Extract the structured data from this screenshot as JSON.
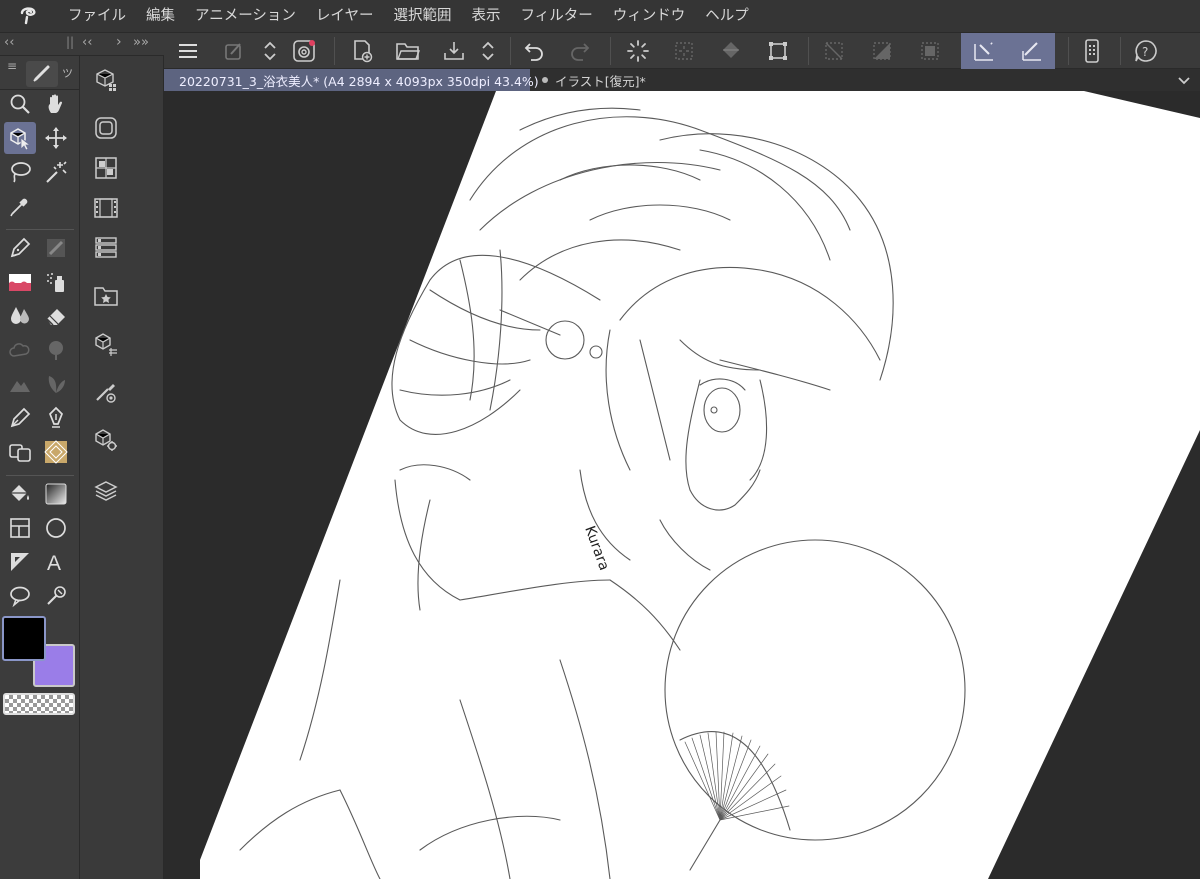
{
  "menu": {
    "items": [
      "ファイル",
      "編集",
      "アニメーション",
      "レイヤー",
      "選択範囲",
      "表示",
      "フィルター",
      "ウィンドウ",
      "ヘルプ"
    ]
  },
  "palette_header": {
    "collapse_left": "‹‹",
    "grip": "||",
    "collapse_right": "‹‹",
    "nav_right": "›",
    "expand_right": "»»"
  },
  "tool_tabs": {
    "menu_icon": "≡",
    "sub_label": "ツ"
  },
  "tabs": [
    {
      "label": "20220731_3_浴衣美人* (A4 2894 x 4093px 350dpi 43.4%)",
      "active": true
    },
    {
      "label": "イラスト[復元]*",
      "active": false
    }
  ],
  "canvas": {
    "signature": "Kurara"
  },
  "colors": {
    "main_color": "#000000",
    "sub_color": "#9a7de8",
    "accent": "#6b7294"
  }
}
